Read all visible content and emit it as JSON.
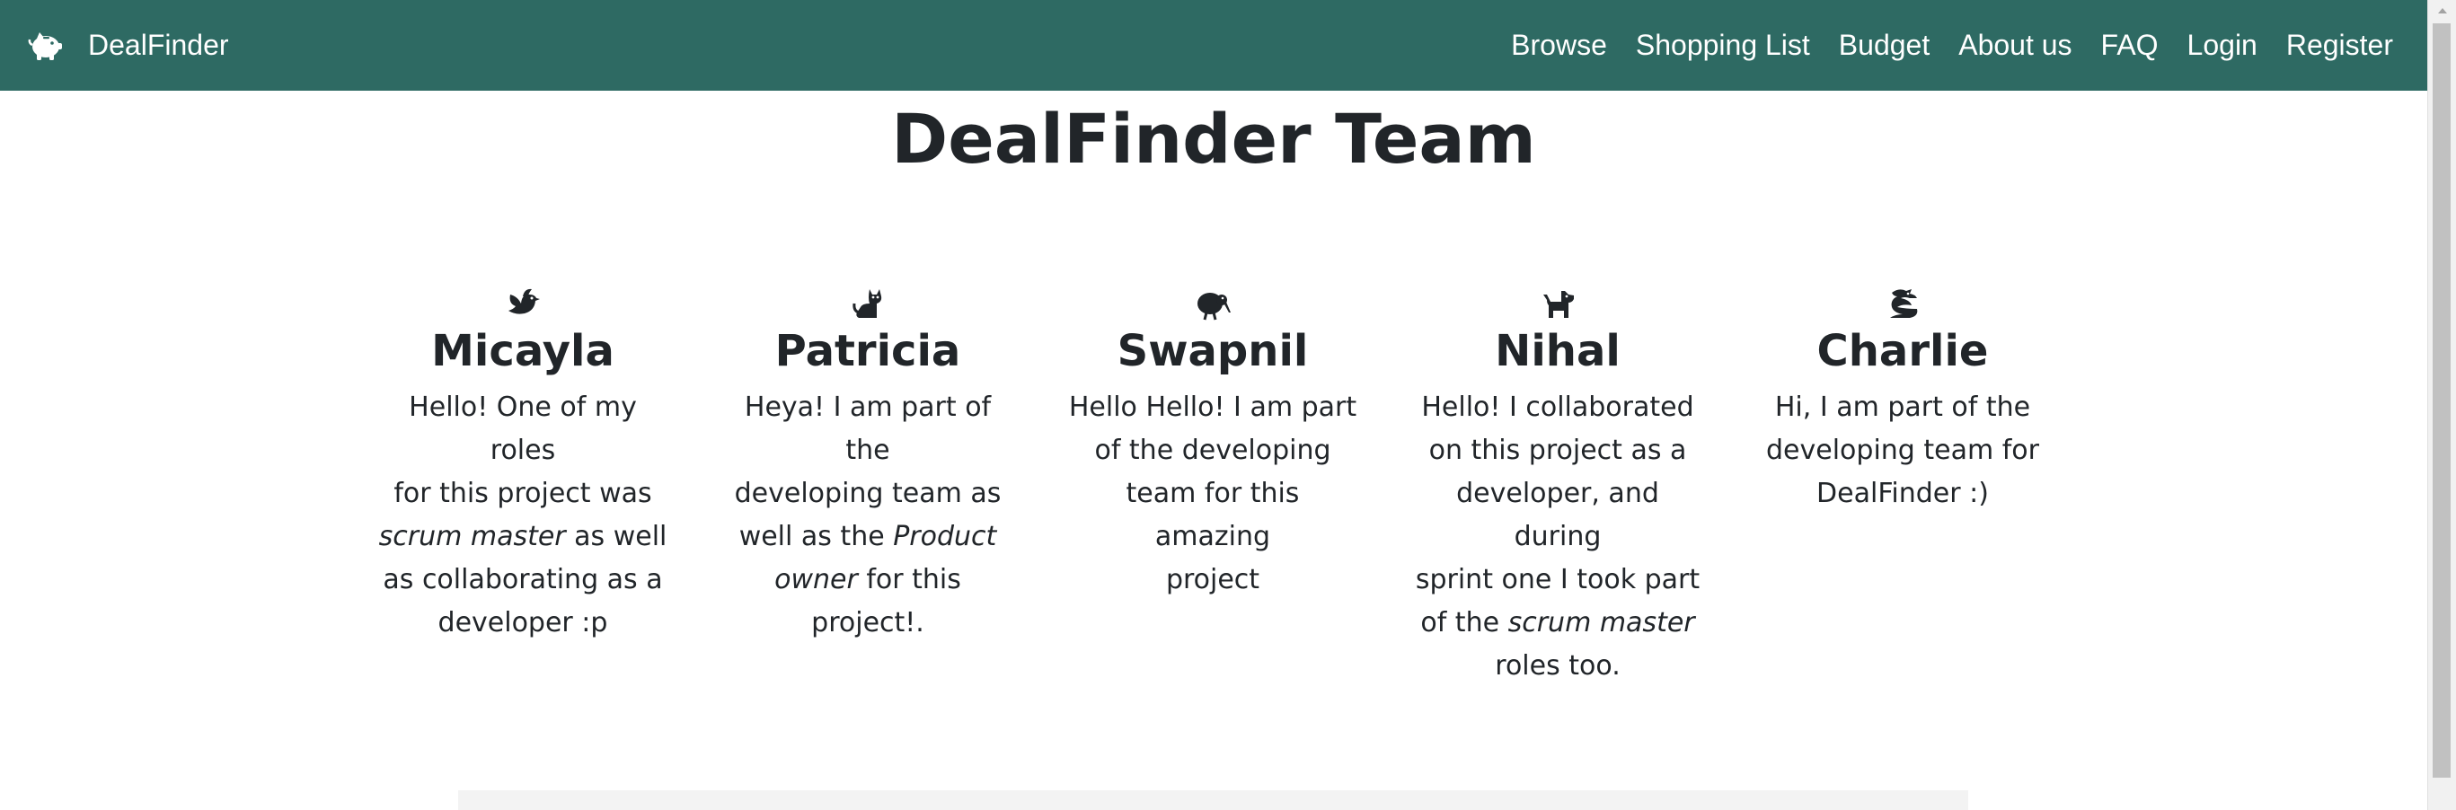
{
  "navbar": {
    "brand": "DealFinder",
    "brand_icon": "piggy-bank-icon",
    "background": "#2e6a63",
    "links": [
      "Browse",
      "Shopping List",
      "Budget",
      "About us",
      "FAQ",
      "Login",
      "Register"
    ]
  },
  "page": {
    "title": "DealFinder Team"
  },
  "team": [
    {
      "name": "Micayla",
      "icon": "dove-icon",
      "bio": [
        "Hello! One of my roles",
        "for this project was",
        "",
        "as collaborating as a",
        "developer :p"
      ],
      "bio_italic_line": {
        "italic": "scrum master",
        "rest": " as well"
      }
    },
    {
      "name": "Patricia",
      "icon": "cat-icon",
      "bio": [
        "Heya! I am part of the",
        "developing team as",
        "well as the ",
        "owner",
        " for this project!."
      ],
      "italic_a": "Product",
      "italic_b": "owner"
    },
    {
      "name": "Swapnil",
      "icon": "kiwi-bird-icon",
      "bio": [
        "Hello Hello! I am part",
        "of the developing",
        "team for this amazing",
        "project"
      ]
    },
    {
      "name": "Nihal",
      "icon": "dog-icon",
      "bio": [
        "Hello! I collaborated",
        "on this project as a",
        "developer, and during",
        "sprint one I took part",
        "of the ",
        "scrum master",
        "roles too."
      ]
    },
    {
      "name": "Charlie",
      "icon": "dragon-icon",
      "bio": [
        "Hi, I am part of the",
        "developing team for",
        "DealFinder :)"
      ]
    }
  ]
}
